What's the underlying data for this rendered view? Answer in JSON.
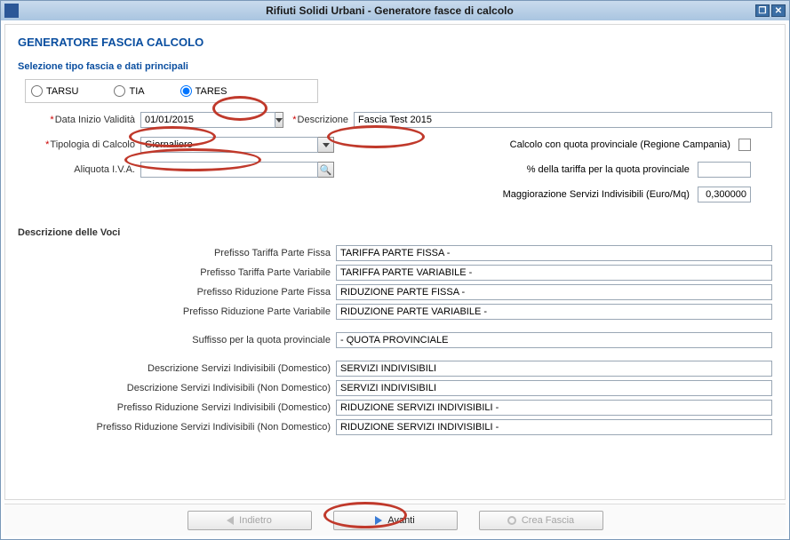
{
  "window": {
    "title": "Rifiuti Solidi Urbani - Generatore fasce di calcolo"
  },
  "header": {
    "title": "GENERATORE FASCIA CALCOLO"
  },
  "section1": {
    "title": "Selezione tipo fascia e dati principali",
    "radios": {
      "tarsu": "TARSU",
      "tia": "TIA",
      "tares": "TARES"
    },
    "data_inizio_lbl": "Data Inizio Validità",
    "data_inizio_val": "01/01/2015",
    "descrizione_lbl": "Descrizione",
    "descrizione_val": "Fascia Test 2015",
    "tipologia_lbl": "Tipologia di Calcolo",
    "tipologia_val": "Giornaliero",
    "aliquota_lbl": "Aliquota I.V.A.",
    "aliquota_val": "",
    "opt_campania": "Calcolo con quota provinciale (Regione Campania)",
    "opt_percent": "% della tariffa per la quota provinciale",
    "opt_magg": "Maggiorazione Servizi Indivisibili (Euro/Mq)",
    "opt_magg_val": "0,300000"
  },
  "voci": {
    "title": "Descrizione delle Voci",
    "rows": [
      {
        "lbl": "Prefisso Tariffa Parte Fissa",
        "val": "TARIFFA PARTE FISSA -"
      },
      {
        "lbl": "Prefisso Tariffa Parte Variabile",
        "val": "TARIFFA PARTE VARIABILE -"
      },
      {
        "lbl": "Prefisso Riduzione Parte Fissa",
        "val": "RIDUZIONE PARTE FISSA -"
      },
      {
        "lbl": "Prefisso Riduzione Parte Variabile",
        "val": "RIDUZIONE PARTE VARIABILE -"
      },
      {
        "lbl": "Suffisso per la quota provinciale",
        "val": "- QUOTA PROVINCIALE"
      },
      {
        "lbl": "Descrizione Servizi Indivisibili (Domestico)",
        "val": "SERVIZI INDIVISIBILI"
      },
      {
        "lbl": "Descrizione Servizi Indivisibili (Non Domestico)",
        "val": "SERVIZI INDIVISIBILI"
      },
      {
        "lbl": "Prefisso Riduzione Servizi Indivisibili (Domestico)",
        "val": "RIDUZIONE SERVIZI INDIVISIBILI -"
      },
      {
        "lbl": "Prefisso Riduzione Servizi Indivisibili (Non Domestico)",
        "val": "RIDUZIONE SERVIZI INDIVISIBILI -"
      }
    ]
  },
  "footer": {
    "back": "Indietro",
    "next": "Avanti",
    "create": "Crea Fascia"
  }
}
